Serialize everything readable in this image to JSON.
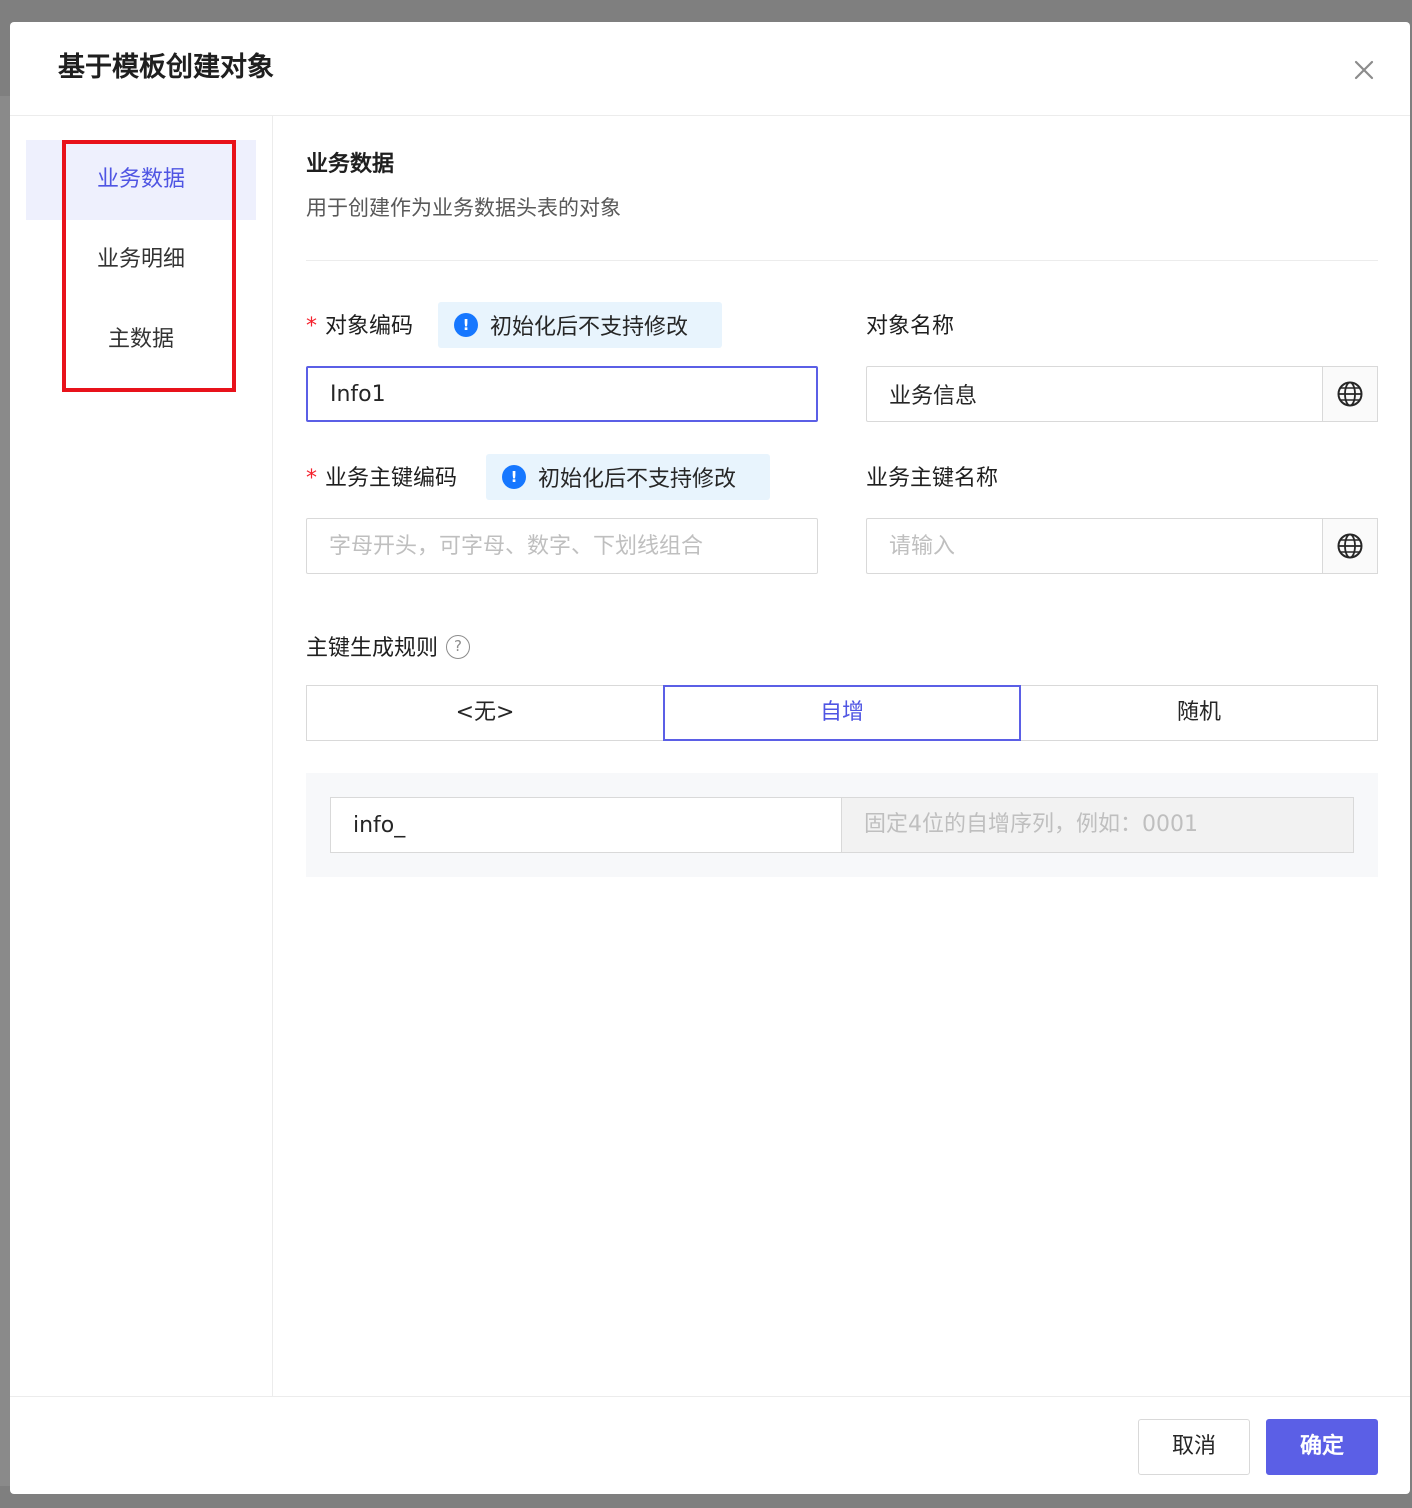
{
  "modal": {
    "title": "基于模板创建对象"
  },
  "sidebar": {
    "items": [
      {
        "label": "业务数据",
        "active": true
      },
      {
        "label": "业务明细",
        "active": false
      },
      {
        "label": "主数据",
        "active": false
      }
    ]
  },
  "section": {
    "title": "业务数据",
    "description": "用于创建作为业务数据头表的对象"
  },
  "fields": {
    "object_code": {
      "label": "对象编码",
      "required": "*",
      "notice": "初始化后不支持修改",
      "value": "Info1"
    },
    "object_name": {
      "label": "对象名称",
      "value": "业务信息"
    },
    "pk_code": {
      "label": "业务主键编码",
      "required": "*",
      "notice": "初始化后不支持修改",
      "placeholder": "字母开头，可字母、数字、下划线组合"
    },
    "pk_name": {
      "label": "业务主键名称",
      "placeholder": "请输入"
    },
    "pk_rule": {
      "label": "主键生成规则",
      "help": "?",
      "options": [
        "<无>",
        "自增",
        "随机"
      ],
      "selected": "自增",
      "prefix": "info_",
      "suffix_hint": "固定4位的自增序列，例如：0001"
    }
  },
  "footer": {
    "cancel_label": "取消",
    "ok_label": "确定"
  },
  "colors": {
    "accent": "#5b5fe6",
    "highlight_border": "#e8121b",
    "notice_bg": "#e8f4fd",
    "info_icon": "#1677ff",
    "required": "#f5222d"
  },
  "icons": {
    "close": "close-icon",
    "globe": "globe-icon",
    "info": "info-icon",
    "help": "question-circle-icon"
  }
}
